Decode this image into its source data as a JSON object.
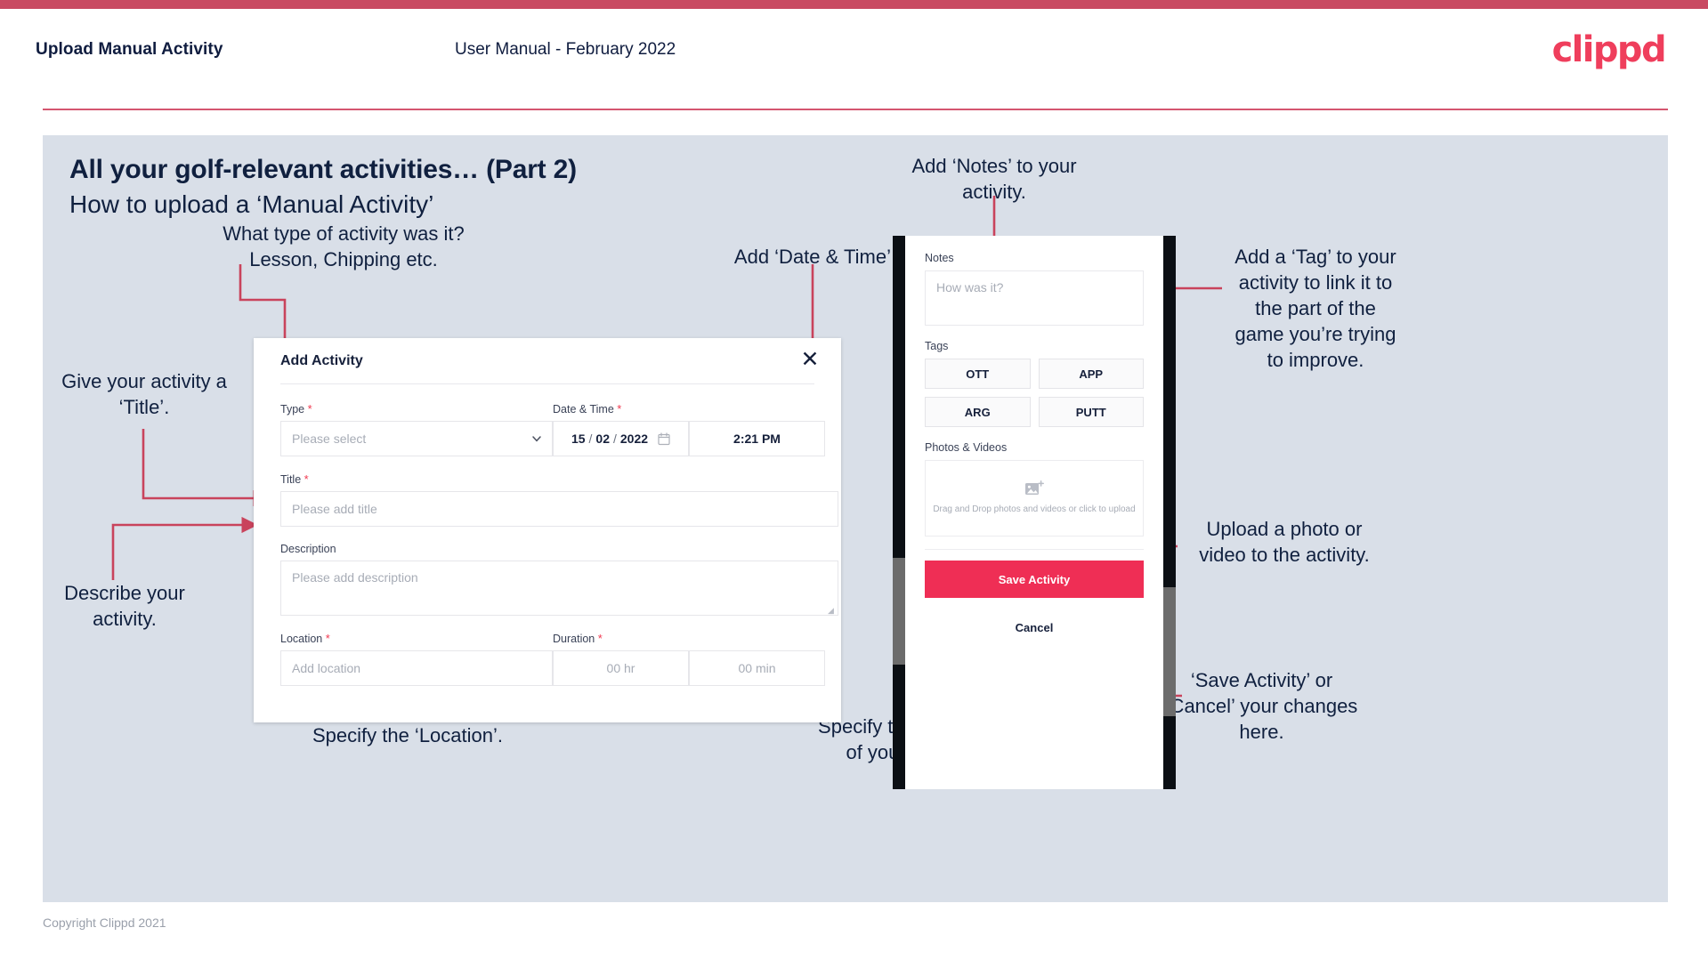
{
  "header": {
    "title": "Upload Manual Activity",
    "subtitle": "User Manual - February 2022",
    "logo": "clippd"
  },
  "slide": {
    "title": "All your golf-relevant activities… (Part 2)",
    "subtitle": "How to upload a ‘Manual Activity’"
  },
  "annotations": {
    "type": "What type of activity was it?\nLesson, Chipping etc.",
    "datetime": "Add ‘Date & Time’.",
    "title": "Give your activity a\n‘Title’.",
    "description": "Describe your\nactivity.",
    "location": "Specify the ‘Location’.",
    "duration": "Specify the ‘Duration’\nof your activity.",
    "notes": "Add ‘Notes’ to your\nactivity.",
    "tags": "Add a ‘Tag’ to your\nactivity to link it to\nthe part of the\ngame you’re trying\nto improve.",
    "photos": "Upload a photo or\nvideo to the activity.",
    "save": "‘Save Activity’ or\n‘Cancel’ your changes\nhere."
  },
  "dialog": {
    "title": "Add Activity",
    "close_icon": "close-icon",
    "fields": {
      "type": {
        "label": "Type",
        "required": "*",
        "placeholder": "Please select",
        "icon": "chevron-down-icon"
      },
      "datetime": {
        "label": "Date & Time",
        "required": "*",
        "day": "15",
        "sep1": "/",
        "month": "02",
        "sep2": "/",
        "year": "2022",
        "calendar_icon": "calendar-icon",
        "time": "2:21 PM"
      },
      "title": {
        "label": "Title",
        "required": "*",
        "placeholder": "Please add title"
      },
      "description": {
        "label": "Description",
        "required": "",
        "placeholder": "Please add description"
      },
      "location": {
        "label": "Location",
        "required": "*",
        "placeholder": "Add location"
      },
      "duration": {
        "label": "Duration",
        "required": "*",
        "hours_placeholder": "00 hr",
        "minutes_placeholder": "00 min"
      }
    }
  },
  "phone": {
    "notes": {
      "label": "Notes",
      "placeholder": "How was it?"
    },
    "tags": {
      "label": "Tags",
      "items": [
        "OTT",
        "APP",
        "ARG",
        "PUTT"
      ]
    },
    "photos": {
      "label": "Photos & Videos",
      "icon": "add-image-icon",
      "drop_text": "Drag and Drop photos and videos or\nclick to upload"
    },
    "save_label": "Save Activity",
    "cancel_label": "Cancel"
  },
  "footer": {
    "copyright": "Copyright Clippd 2021"
  },
  "colors": {
    "accent_pink": "#ef2e55",
    "top_bar": "#c94a62",
    "arrow": "#c9435c",
    "slide_bg": "#d9dfe8",
    "navy_text": "#10203f"
  }
}
